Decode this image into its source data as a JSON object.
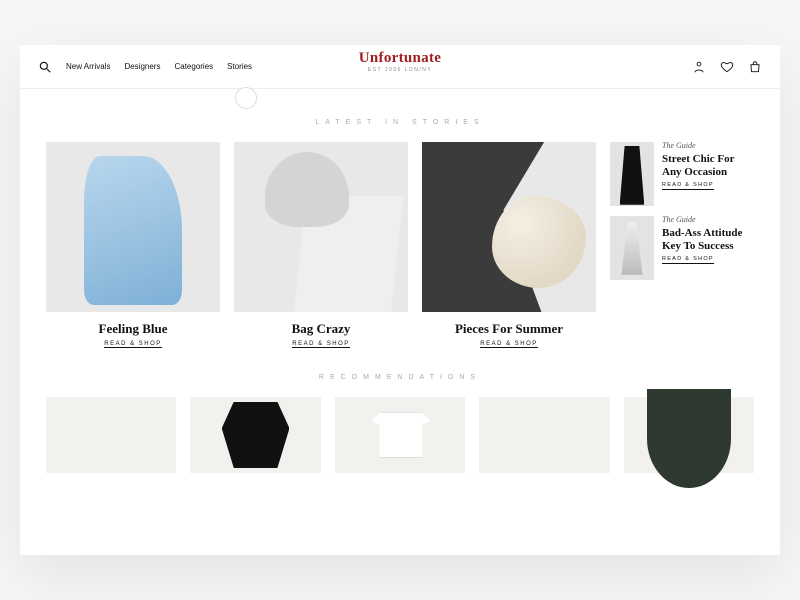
{
  "brand": {
    "name": "Unfortunate",
    "tagline": "EST 2006 LDN/NY",
    "brand_color": "#a11e1e"
  },
  "nav": {
    "items": [
      "New Arrivals",
      "Designers",
      "Categories",
      "Stories"
    ]
  },
  "sections": {
    "stories_heading": "LATEST IN STORIES",
    "recs_heading": "RECOMMENDATIONS"
  },
  "cta_label": "READ & SHOP",
  "stories": [
    {
      "title": "Feeling Blue"
    },
    {
      "title": "Bag Crazy"
    },
    {
      "title": "Pieces For Summer"
    }
  ],
  "side_stories": [
    {
      "eyebrow": "The Guide",
      "headline": "Street Chic For Any Occasion"
    },
    {
      "eyebrow": "The Guide",
      "headline": "Bad-Ass Attitude Key To Success"
    }
  ]
}
